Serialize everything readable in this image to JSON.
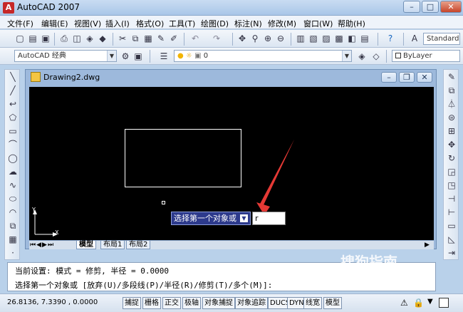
{
  "window": {
    "title": "AutoCAD 2007",
    "app_icon": "autocad-logo-icon"
  },
  "menubar": {
    "items": [
      "文件(F)",
      "编辑(E)",
      "视图(V)",
      "插入(I)",
      "格式(O)",
      "工具(T)",
      "绘图(D)",
      "标注(N)",
      "修改(M)",
      "窗口(W)",
      "帮助(H)"
    ]
  },
  "toolbar2": {
    "workspace": "AutoCAD 经典",
    "layer_value": "0",
    "linetype": "ByLayer",
    "text_style": "Standard"
  },
  "drawing": {
    "title": "Drawing2.dwg",
    "axis_y": "Y",
    "axis_x": "X"
  },
  "layout_tabs": [
    "模型",
    "布局1",
    "布局2"
  ],
  "dynamic_input": {
    "prompt": "选择第一个对象或",
    "value": "r"
  },
  "command": {
    "line1": "当前设置: 模式 = 修剪, 半径 = 0.0000",
    "line2": "选择第一个对象或 [放弃(U)/多段线(P)/半径(R)/修剪(T)/多个(M)]:"
  },
  "status": {
    "coords": "26.8136, 7.3390 , 0.0000",
    "buttons": [
      "捕捉",
      "栅格",
      "正交",
      "极轴",
      "对象捕捉",
      "对象追踪",
      "DUCS",
      "DYN",
      "线宽",
      "模型"
    ]
  },
  "watermark": "搜狗指南",
  "colors": {
    "canvas": "#000000",
    "accent": "#2d3a8c",
    "arrow": "#e53935"
  }
}
